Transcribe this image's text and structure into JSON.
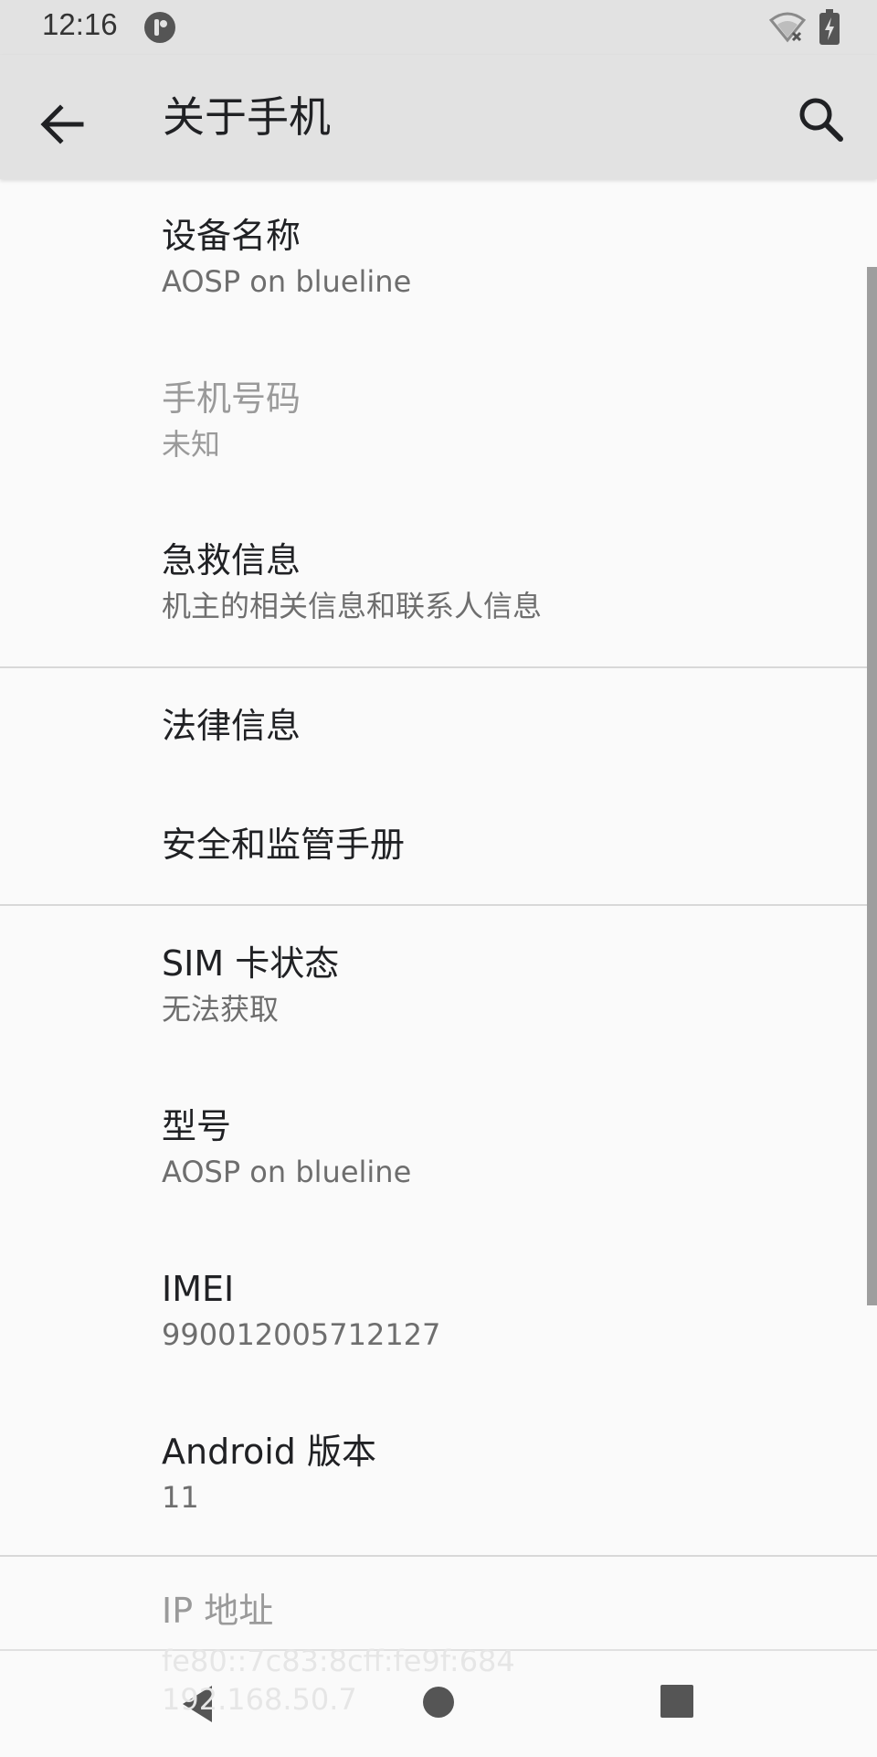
{
  "status_bar": {
    "time": "12:16",
    "icons": [
      "app-notification-icon",
      "wifi-off-icon",
      "battery-charging-icon"
    ]
  },
  "app_bar": {
    "title": "关于手机",
    "back_icon": "arrow-back-icon",
    "search_icon": "search-icon",
    "background": "#e2e2e2"
  },
  "items": [
    {
      "title": "设备名称",
      "summary": "AOSP on blueline",
      "enabled": true
    },
    {
      "title": "手机号码",
      "summary": "未知",
      "enabled": false
    },
    {
      "title": "急救信息",
      "summary": "机主的相关信息和联系人信息",
      "enabled": true
    },
    {
      "title": "法律信息",
      "enabled": true
    },
    {
      "title": "安全和监管手册",
      "enabled": true
    },
    {
      "title": "SIM 卡状态",
      "summary": "无法获取",
      "enabled": true
    },
    {
      "title": "型号",
      "summary": "AOSP on blueline",
      "enabled": true
    },
    {
      "title": "IMEI",
      "summary": "990012005712127",
      "enabled": true
    },
    {
      "title": "Android 版本",
      "summary": "11",
      "enabled": true
    },
    {
      "title": "IP 地址",
      "summary": "fe80::7c83:8cff:fe9f:684",
      "summary2": "192.168.50.7",
      "enabled": false
    }
  ],
  "nav_bar": {
    "buttons": [
      "nav-back-icon",
      "nav-home-icon",
      "nav-recents-icon"
    ]
  },
  "colors": {
    "background": "#fafafa",
    "title_text": "#202124",
    "summary_text": "#6e6e6e",
    "disabled_text": "#9a9a9a"
  }
}
